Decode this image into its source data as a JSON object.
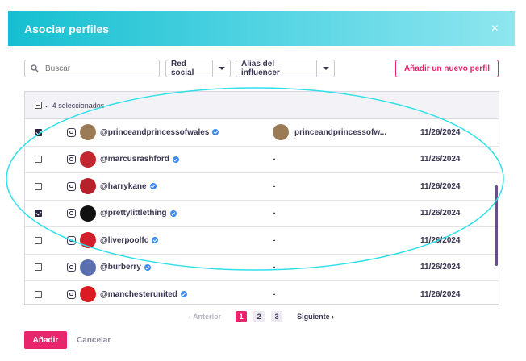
{
  "header": {
    "title": "Asociar perfiles",
    "close_icon": "×"
  },
  "toolbar": {
    "search_placeholder": "Buscar",
    "filter_network": "Red social",
    "filter_alias": "Alias del influencer",
    "add_profile": "Añadir un nuevo perfil"
  },
  "table": {
    "selected_label": "4 seleccionados",
    "rows": [
      {
        "handle": "@princeandprincessofwales",
        "alias": "princeandprincessofw...",
        "date": "11/26/2024",
        "checked": true,
        "avatar_color": "#9a7b56"
      },
      {
        "handle": "@marcusrashford",
        "alias": "-",
        "date": "11/26/2024",
        "checked": false,
        "avatar_color": "#c2262e"
      },
      {
        "handle": "@harrykane",
        "alias": "-",
        "date": "11/26/2024",
        "checked": false,
        "avatar_color": "#b8202a"
      },
      {
        "handle": "@prettylittlething",
        "alias": "-",
        "date": "11/26/2024",
        "checked": true,
        "avatar_color": "#111111"
      },
      {
        "handle": "@liverpoolfc",
        "alias": "-",
        "date": "11/26/2024",
        "checked": false,
        "avatar_color": "#d11f2b"
      },
      {
        "handle": "@burberry",
        "alias": "-",
        "date": "11/26/2024",
        "checked": false,
        "avatar_color": "#5a6fb0"
      },
      {
        "handle": "@manchesterunited",
        "alias": "-",
        "date": "11/26/2024",
        "checked": false,
        "avatar_color": "#d81c20"
      }
    ]
  },
  "pagination": {
    "prev": "Anterior",
    "next": "Siguiente",
    "pages": [
      "1",
      "2",
      "3"
    ],
    "active": "1"
  },
  "footer": {
    "add": "Añadir",
    "cancel": "Cancelar"
  },
  "colors": {
    "accent": "#e8256c",
    "header_start": "#15bfd0",
    "annotation": "#2ee0e8"
  }
}
